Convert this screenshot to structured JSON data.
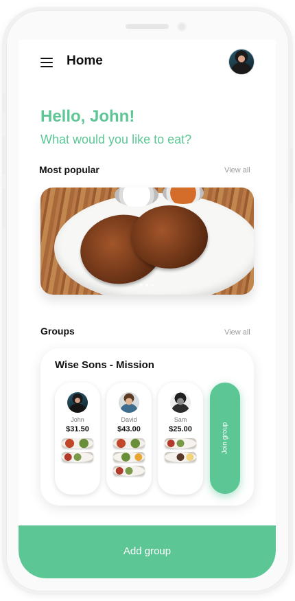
{
  "header": {
    "title": "Home",
    "menu_icon": "hamburger-menu-icon",
    "profile_icon": "user-avatar"
  },
  "greeting": {
    "hello": "Hello, John!",
    "question": "What would you like to eat?"
  },
  "most_popular": {
    "title": "Most popular",
    "view_all": "View all",
    "carousel_dots": 3,
    "active_dot": 2
  },
  "groups": {
    "title": "Groups",
    "view_all": "View all",
    "card": {
      "name": "Wise Sons - Mission",
      "members": [
        {
          "name": "John",
          "amount": "$31.50",
          "dishes": 2
        },
        {
          "name": "David",
          "amount": "$43.00",
          "dishes": 3
        },
        {
          "name": "Sam",
          "amount": "$25.00",
          "dishes": 2
        }
      ],
      "join_label": "Join group"
    }
  },
  "footer": {
    "add_group_label": "Add group"
  },
  "colors": {
    "accent": "#5cc795",
    "text": "#111111",
    "muted": "#9a9a9a"
  }
}
